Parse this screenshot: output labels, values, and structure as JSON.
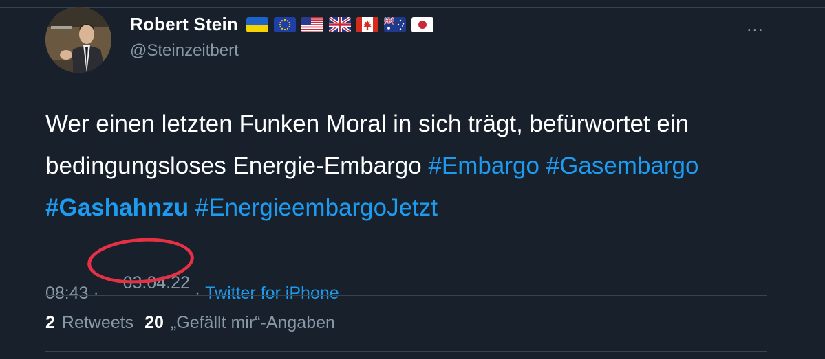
{
  "author": {
    "display_name": "Robert Stein",
    "handle": "@Steinzeitbert",
    "flags": [
      "ukraine-flag",
      "eu-flag",
      "usa-flag",
      "uk-flag",
      "canada-flag",
      "australia-flag",
      "japan-flag"
    ]
  },
  "tweet": {
    "text_plain": "Wer einen letzten Funken Moral in sich trägt, befürwortet ein bedingungsloses Energie-Embargo ",
    "hashtags": [
      "#Embargo",
      "#Gasembargo",
      "#Gashahnzu",
      "#EnergieembargoJetzt"
    ]
  },
  "meta": {
    "time": "08:43",
    "separator": " · ",
    "date": "03.04.22",
    "source": "Twitter for iPhone"
  },
  "stats": {
    "retweets_count": "2",
    "retweets_label": "Retweets",
    "likes_count": "20",
    "likes_label": "„Gefällt mir“-Angaben"
  },
  "more_icon": "…",
  "colors": {
    "background": "#17202b",
    "link": "#1d9bf0",
    "secondary_text": "#8899a6",
    "highlight_circle": "#e63045"
  }
}
